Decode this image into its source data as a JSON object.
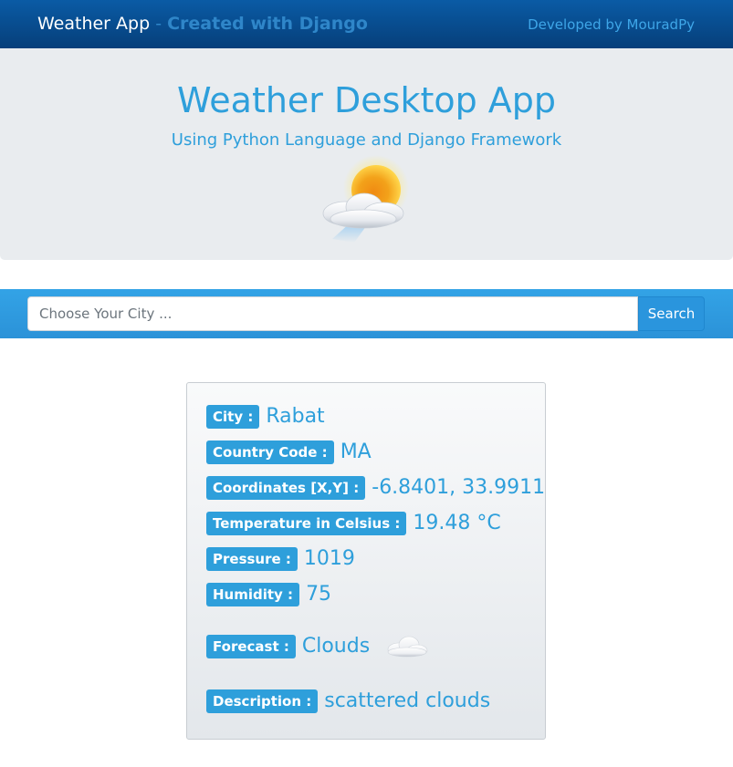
{
  "navbar": {
    "brand": "Weather App",
    "separator": " - ",
    "brand_sub": "Created with Django",
    "dev_link": "Developed by MouradPy"
  },
  "hero": {
    "title": "Weather Desktop App",
    "subtitle": "Using Python Language and Django Framework",
    "icon": "sun-behind-cloud-icon"
  },
  "search": {
    "placeholder": "Choose Your City ...",
    "value": "",
    "button_label": "Search"
  },
  "result": {
    "city": {
      "label": "City :",
      "value": "Rabat"
    },
    "country": {
      "label": "Country Code :",
      "value": "MA"
    },
    "coordinates": {
      "label": "Coordinates [X,Y] :",
      "value": "-6.8401, 33.9911"
    },
    "temperature": {
      "label": "Temperature in Celsius :",
      "value": "19.48 °C"
    },
    "pressure": {
      "label": "Pressure :",
      "value": "1019"
    },
    "humidity": {
      "label": "Humidity :",
      "value": "75"
    },
    "forecast": {
      "label": "Forecast :",
      "value": "Clouds",
      "icon": "cloud-icon"
    },
    "description": {
      "label": "Description :",
      "value": "scattered clouds"
    }
  },
  "colors": {
    "navbar": "#063f7a",
    "accent": "#2e9fdb",
    "hero_bg": "#e9ecef"
  }
}
